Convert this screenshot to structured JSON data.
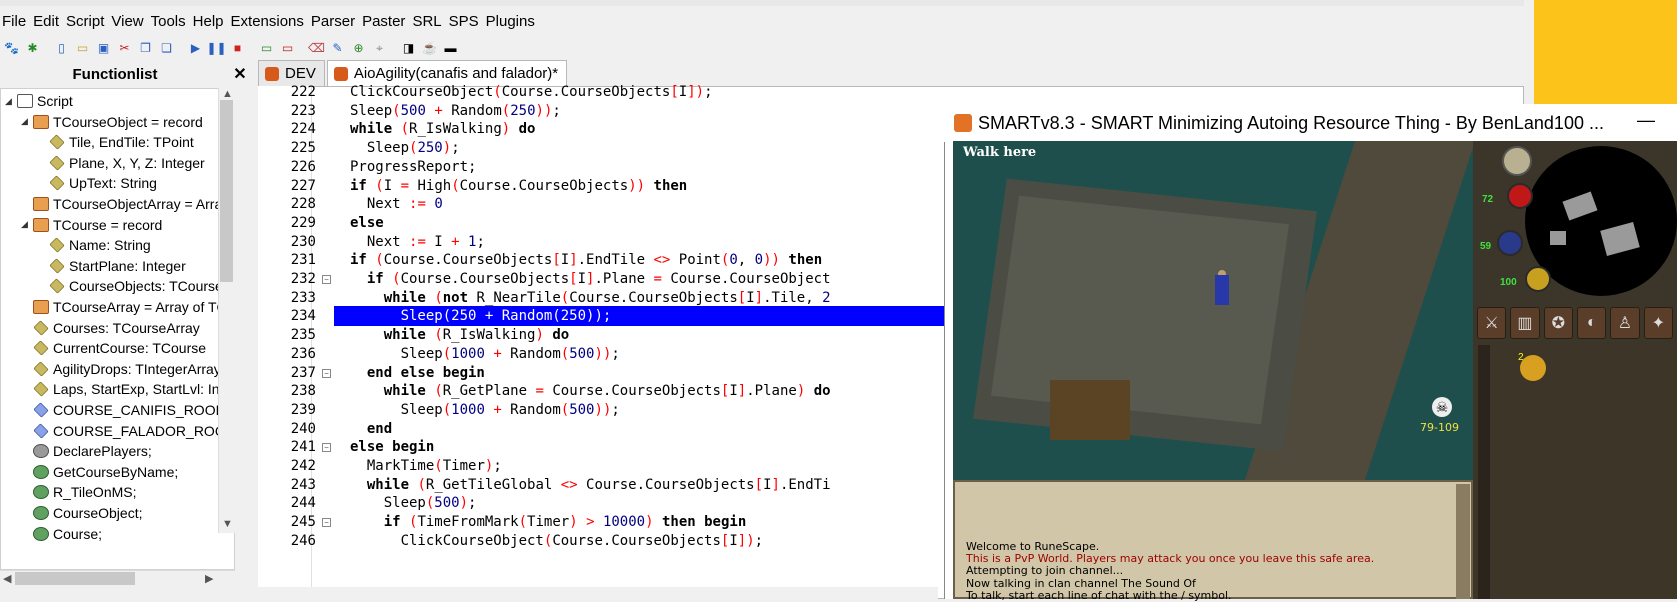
{
  "menu": [
    "File",
    "Edit",
    "Script",
    "View",
    "Tools",
    "Help",
    "Extensions",
    "Parser",
    "Paster",
    "SRL",
    "SPS",
    "Plugins"
  ],
  "functionlist": {
    "title": "Functionlist",
    "close": "✕",
    "items": [
      {
        "label": "Script",
        "indent": 0,
        "icon": "script",
        "exp": "◢"
      },
      {
        "label": "TCourseObject = record",
        "indent": 1,
        "icon": "record",
        "exp": "◢"
      },
      {
        "label": "Tile, EndTile: TPoint",
        "indent": 2,
        "icon": "field",
        "exp": ""
      },
      {
        "label": "Plane, X, Y, Z: Integer",
        "indent": 2,
        "icon": "field",
        "exp": ""
      },
      {
        "label": "UpText: String",
        "indent": 2,
        "icon": "field",
        "exp": ""
      },
      {
        "label": "TCourseObjectArray = Array",
        "indent": 1,
        "icon": "record",
        "exp": ""
      },
      {
        "label": "TCourse = record",
        "indent": 1,
        "icon": "record",
        "exp": "◢"
      },
      {
        "label": "Name: String",
        "indent": 2,
        "icon": "field",
        "exp": ""
      },
      {
        "label": "StartPlane: Integer",
        "indent": 2,
        "icon": "field",
        "exp": ""
      },
      {
        "label": "CourseObjects: TCourseO",
        "indent": 2,
        "icon": "field",
        "exp": ""
      },
      {
        "label": "TCourseArray = Array of TC",
        "indent": 1,
        "icon": "record",
        "exp": ""
      },
      {
        "label": "Courses: TCourseArray",
        "indent": 1,
        "icon": "field",
        "exp": ""
      },
      {
        "label": "CurrentCourse: TCourse",
        "indent": 1,
        "icon": "field",
        "exp": ""
      },
      {
        "label": "AgilityDrops: TIntegerArray",
        "indent": 1,
        "icon": "field",
        "exp": ""
      },
      {
        "label": "Laps, StartExp, StartLvl: Inte",
        "indent": 1,
        "icon": "field",
        "exp": ""
      },
      {
        "label": "COURSE_CANIFIS_ROOFTOP",
        "indent": 1,
        "icon": "const",
        "exp": ""
      },
      {
        "label": "COURSE_FALADOR_ROOFTO",
        "indent": 1,
        "icon": "const",
        "exp": ""
      },
      {
        "label": "DeclarePlayers;",
        "indent": 1,
        "icon": "proc",
        "exp": ""
      },
      {
        "label": "GetCourseByName;",
        "indent": 1,
        "icon": "func",
        "exp": ""
      },
      {
        "label": "R_TileOnMS;",
        "indent": 1,
        "icon": "func",
        "exp": ""
      },
      {
        "label": "CourseObject;",
        "indent": 1,
        "icon": "func",
        "exp": ""
      },
      {
        "label": "Course;",
        "indent": 1,
        "icon": "func",
        "exp": ""
      }
    ]
  },
  "tabs": [
    {
      "label": "DEV",
      "active": false
    },
    {
      "label": "AioAgility(canafis and falador)*",
      "active": true
    }
  ],
  "editor": {
    "highlighted_line": 234,
    "lines": [
      {
        "n": "222",
        "fold": false,
        "html": "ClickCourseObject<span class=\"br\">(</span>Course.CourseObjects<span class=\"br\">[</span>I<span class=\"br\">]</span><span class=\"br\">)</span>;",
        "indent": 0
      },
      {
        "n": "223",
        "fold": false,
        "html": "Sleep<span class=\"br\">(</span><span class=\"num\">500</span> <span class=\"op\">+</span> Random<span class=\"br\">(</span><span class=\"num\">250</span><span class=\"br\">)</span><span class=\"br\">)</span>;",
        "indent": 0
      },
      {
        "n": "224",
        "fold": false,
        "html": "<span class=\"kw\">while</span> <span class=\"br\">(</span>R_IsWalking<span class=\"br\">)</span> <span class=\"kw\">do</span>",
        "indent": 0
      },
      {
        "n": "225",
        "fold": false,
        "html": "  Sleep<span class=\"br\">(</span><span class=\"num\">250</span><span class=\"br\">)</span>;",
        "indent": 1
      },
      {
        "n": "226",
        "fold": false,
        "html": "ProgressReport;",
        "indent": 0
      },
      {
        "n": "227",
        "fold": false,
        "html": "<span class=\"kw\">if</span> <span class=\"br\">(</span>I <span class=\"op\">=</span> High<span class=\"br\">(</span>Course.CourseObjects<span class=\"br\">)</span><span class=\"br\">)</span> <span class=\"kw\">then</span>",
        "indent": 0
      },
      {
        "n": "228",
        "fold": false,
        "html": "  Next <span class=\"op\">:=</span> <span class=\"num\">0</span>",
        "indent": 1
      },
      {
        "n": "229",
        "fold": false,
        "html": "<span class=\"kw\">else</span>",
        "indent": 0
      },
      {
        "n": "230",
        "fold": false,
        "html": "  Next <span class=\"op\">:=</span> I <span class=\"op\">+</span> <span class=\"num\">1</span>;",
        "indent": 1
      },
      {
        "n": "231",
        "fold": false,
        "html": "<span class=\"kw\">if</span> <span class=\"br\">(</span>Course.CourseObjects<span class=\"br\">[</span>I<span class=\"br\">]</span>.EndTile <span class=\"op\">&lt;&gt;</span> Point<span class=\"br\">(</span><span class=\"num\">0</span>, <span class=\"num\">0</span><span class=\"br\">)</span><span class=\"br\">)</span> <span class=\"kw\">then</span>",
        "indent": 0
      },
      {
        "n": "232",
        "fold": true,
        "html": "  <span class=\"kw\">if</span> <span class=\"br\">(</span>Course.CourseObjects<span class=\"br\">[</span>I<span class=\"br\">]</span>.Plane <span class=\"op\">=</span> Course.CourseObject",
        "indent": 1
      },
      {
        "n": "233",
        "fold": false,
        "html": "    <span class=\"kw\">while</span> <span class=\"br\">(</span><span class=\"kw\">not</span> R_NearTile<span class=\"br\">(</span>Course.CourseObjects<span class=\"br\">[</span>I<span class=\"br\">]</span>.Tile, <span class=\"num\">2</span>",
        "indent": 2
      },
      {
        "n": "234",
        "fold": false,
        "html": "      <span class=\"hltext\">Sleep(250 + Random(250));</span>",
        "indent": 3
      },
      {
        "n": "235",
        "fold": false,
        "html": "    <span class=\"kw\">while</span> <span class=\"br\">(</span>R_IsWalking<span class=\"br\">)</span> <span class=\"kw\">do</span>",
        "indent": 2
      },
      {
        "n": "236",
        "fold": false,
        "html": "      Sleep<span class=\"br\">(</span><span class=\"num\">1000</span> <span class=\"op\">+</span> Random<span class=\"br\">(</span><span class=\"num\">500</span><span class=\"br\">)</span><span class=\"br\">)</span>;",
        "indent": 3
      },
      {
        "n": "237",
        "fold": true,
        "html": "  <span class=\"kw\">end else begin</span>",
        "indent": 1
      },
      {
        "n": "238",
        "fold": false,
        "html": "    <span class=\"kw\">while</span> <span class=\"br\">(</span>R_GetPlane <span class=\"op\">=</span> Course.CourseObjects<span class=\"br\">[</span>I<span class=\"br\">]</span>.Plane<span class=\"br\">)</span> <span class=\"kw\">do</span>",
        "indent": 2
      },
      {
        "n": "239",
        "fold": false,
        "html": "      Sleep<span class=\"br\">(</span><span class=\"num\">1000</span> <span class=\"op\">+</span> Random<span class=\"br\">(</span><span class=\"num\">500</span><span class=\"br\">)</span><span class=\"br\">)</span>;",
        "indent": 3
      },
      {
        "n": "240",
        "fold": false,
        "html": "  <span class=\"kw\">end</span>",
        "indent": 1
      },
      {
        "n": "241",
        "fold": true,
        "html": "<span class=\"kw\">else begin</span>",
        "indent": 0
      },
      {
        "n": "242",
        "fold": false,
        "html": "  MarkTime<span class=\"br\">(</span>Timer<span class=\"br\">)</span>;",
        "indent": 1
      },
      {
        "n": "243",
        "fold": false,
        "html": "  <span class=\"kw\">while</span> <span class=\"br\">(</span>R_GetTileGlobal <span class=\"op\">&lt;&gt;</span> Course.CourseObjects<span class=\"br\">[</span>I<span class=\"br\">]</span>.EndTi",
        "indent": 1
      },
      {
        "n": "244",
        "fold": false,
        "html": "    Sleep<span class=\"br\">(</span><span class=\"num\">500</span><span class=\"br\">)</span>;",
        "indent": 2
      },
      {
        "n": "245",
        "fold": true,
        "html": "    <span class=\"kw\">if</span> <span class=\"br\">(</span>TimeFromMark<span class=\"br\">(</span>Timer<span class=\"br\">)</span> <span class=\"op\">&gt;</span> <span class=\"num\">10000</span><span class=\"br\">)</span> <span class=\"kw\">then begin</span>",
        "indent": 2
      },
      {
        "n": "246",
        "fold": false,
        "html": "      ClickCourseObject<span class=\"br\">(</span>Course.CourseObjects<span class=\"br\">[</span>I<span class=\"br\">]</span><span class=\"br\">)</span>;",
        "indent": 3
      }
    ]
  },
  "smart": {
    "title": "SMARTv8.3 - SMART Minimizing Autoing Resource Thing - By BenLand100 ...",
    "minimize": "—",
    "walk_here": "Walk here",
    "wilderness_level": "79-109",
    "orbs": {
      "hp": "72",
      "prayer": "59",
      "run": "100"
    },
    "coin_count": "2",
    "chat": [
      {
        "text": "Welcome to RuneScape.",
        "color": "#000000"
      },
      {
        "text": "This is a PvP World. Players may attack you once you leave this safe area.",
        "color": "#9a0000"
      },
      {
        "text": "Attempting to join channel...",
        "color": "#000000"
      },
      {
        "text": "Now talking in clan channel The Sound Of",
        "color": "#000000"
      },
      {
        "text": "To talk, start each line of chat with the / symbol.",
        "color": "#000000"
      }
    ]
  }
}
